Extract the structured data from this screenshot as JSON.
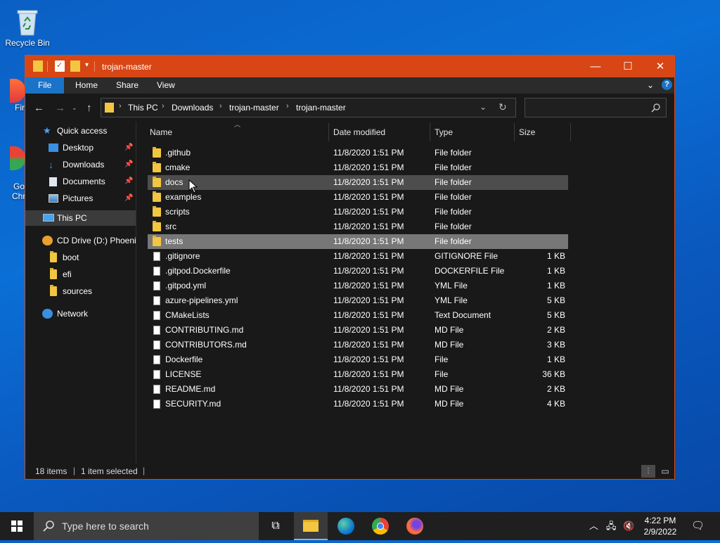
{
  "desktop": {
    "recycle_bin": "Recycle Bin",
    "partial_firefox": "Fir",
    "partial_chrome_1": "Go",
    "partial_chrome_2": "Chr"
  },
  "window": {
    "title": "trojan-master",
    "ribbon_tabs": [
      "File",
      "Home",
      "Share",
      "View"
    ],
    "breadcrumb": [
      "This PC",
      "Downloads",
      "trojan-master",
      "trojan-master"
    ],
    "search_placeholder": ""
  },
  "nav_pane": {
    "quick_access": "Quick access",
    "quick_items": [
      {
        "label": "Desktop",
        "icon": "desktop-icon"
      },
      {
        "label": "Downloads",
        "icon": "download-arrow-icon"
      },
      {
        "label": "Documents",
        "icon": "documents-icon"
      },
      {
        "label": "Pictures",
        "icon": "pictures-icon"
      }
    ],
    "this_pc": "This PC",
    "cd_drive": "CD Drive (D:) Phoenix",
    "cd_items": [
      "boot",
      "efi",
      "sources"
    ],
    "network": "Network"
  },
  "columns": {
    "name": "Name",
    "date": "Date modified",
    "type": "Type",
    "size": "Size"
  },
  "files": [
    {
      "name": ".github",
      "date": "11/8/2020 1:51 PM",
      "type": "File folder",
      "size": "",
      "kind": "folder"
    },
    {
      "name": "cmake",
      "date": "11/8/2020 1:51 PM",
      "type": "File folder",
      "size": "",
      "kind": "folder"
    },
    {
      "name": "docs",
      "date": "11/8/2020 1:51 PM",
      "type": "File folder",
      "size": "",
      "kind": "folder"
    },
    {
      "name": "examples",
      "date": "11/8/2020 1:51 PM",
      "type": "File folder",
      "size": "",
      "kind": "folder"
    },
    {
      "name": "scripts",
      "date": "11/8/2020 1:51 PM",
      "type": "File folder",
      "size": "",
      "kind": "folder"
    },
    {
      "name": "src",
      "date": "11/8/2020 1:51 PM",
      "type": "File folder",
      "size": "",
      "kind": "folder"
    },
    {
      "name": "tests",
      "date": "11/8/2020 1:51 PM",
      "type": "File folder",
      "size": "",
      "kind": "folder"
    },
    {
      "name": ".gitignore",
      "date": "11/8/2020 1:51 PM",
      "type": "GITIGNORE File",
      "size": "1 KB",
      "kind": "file"
    },
    {
      "name": ".gitpod.Dockerfile",
      "date": "11/8/2020 1:51 PM",
      "type": "DOCKERFILE File",
      "size": "1 KB",
      "kind": "file"
    },
    {
      "name": ".gitpod.yml",
      "date": "11/8/2020 1:51 PM",
      "type": "YML File",
      "size": "1 KB",
      "kind": "file"
    },
    {
      "name": "azure-pipelines.yml",
      "date": "11/8/2020 1:51 PM",
      "type": "YML File",
      "size": "5 KB",
      "kind": "file"
    },
    {
      "name": "CMakeLists",
      "date": "11/8/2020 1:51 PM",
      "type": "Text Document",
      "size": "5 KB",
      "kind": "file"
    },
    {
      "name": "CONTRIBUTING.md",
      "date": "11/8/2020 1:51 PM",
      "type": "MD File",
      "size": "2 KB",
      "kind": "file"
    },
    {
      "name": "CONTRIBUTORS.md",
      "date": "11/8/2020 1:51 PM",
      "type": "MD File",
      "size": "3 KB",
      "kind": "file"
    },
    {
      "name": "Dockerfile",
      "date": "11/8/2020 1:51 PM",
      "type": "File",
      "size": "1 KB",
      "kind": "file"
    },
    {
      "name": "LICENSE",
      "date": "11/8/2020 1:51 PM",
      "type": "File",
      "size": "36 KB",
      "kind": "file"
    },
    {
      "name": "README.md",
      "date": "11/8/2020 1:51 PM",
      "type": "MD File",
      "size": "2 KB",
      "kind": "file"
    },
    {
      "name": "SECURITY.md",
      "date": "11/8/2020 1:51 PM",
      "type": "MD File",
      "size": "4 KB",
      "kind": "file"
    }
  ],
  "hover_row": "docs",
  "selected_row": "tests",
  "status": {
    "items": "18 items",
    "selected": "1 item selected"
  },
  "taskbar": {
    "search_placeholder": "Type here to search",
    "time": "4:22 PM",
    "date": "2/9/2022"
  },
  "colors": {
    "titlebar": "#d74614",
    "file_tab": "#1a73c8",
    "folder": "#f3c641",
    "explorer_bg": "#191919"
  }
}
